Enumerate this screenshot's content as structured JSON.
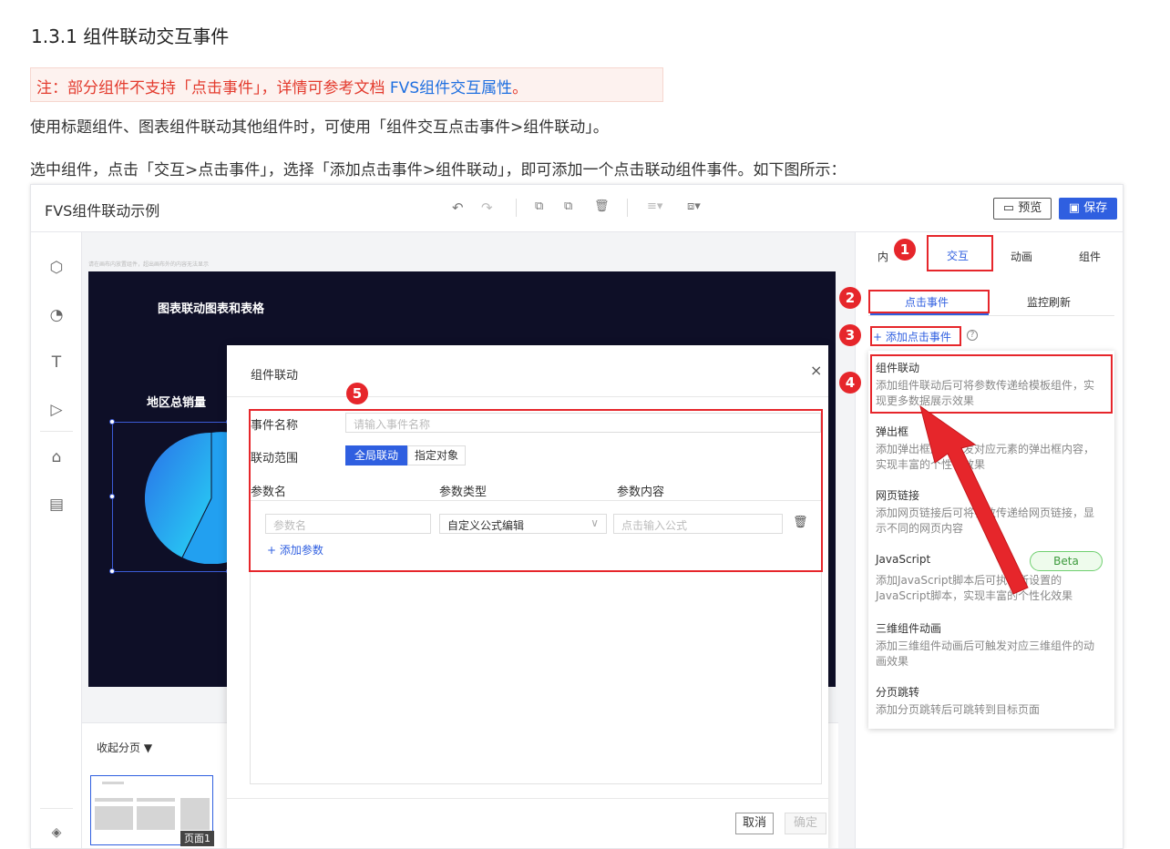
{
  "doc": {
    "title": "1.3.1 组件联动交互事件",
    "note_text": "注：部分组件不支持「点击事件」，详情可参考文档 ",
    "note_link": "FVS组件交互属性",
    "note_dot": "。",
    "para1": "使用标题组件、图表组件联动其他组件时，可使用「组件交互点击事件>组件联动」。",
    "para2": "选中组件，点击「交互>点击事件」，选择「添加点击事件>组件联动」，即可添加一个点击联动组件事件。如下图所示："
  },
  "app": {
    "title": "FVS组件联动示例",
    "preview_label": "预览",
    "save_label": "保存",
    "canvas_hint": "请在画布内放置组件，超出画布外的内容无法显示",
    "canvas_title": "图表联动图表和表格",
    "region_title": "地区总销量",
    "collapse_label": "收起分页 ▼",
    "page_name": "页面1"
  },
  "dialog": {
    "title": "组件联动",
    "close": "×",
    "event_name_label": "事件名称",
    "event_name_placeholder": "请输入事件名称",
    "scope_label": "联动范围",
    "scope_global": "全局联动",
    "scope_target": "指定对象",
    "col_param_name": "参数名",
    "col_param_type": "参数类型",
    "col_param_content": "参数内容",
    "param_name_placeholder": "参数名",
    "param_type_value": "自定义公式编辑",
    "param_content_placeholder": "点击输入公式",
    "add_param": "+ 添加参数",
    "cancel": "取消",
    "ok": "确定"
  },
  "right_panel": {
    "tabs": [
      "内",
      "交互",
      "动画",
      "组件"
    ],
    "subtab_click": "点击事件",
    "subtab_refresh": "监控刷新",
    "add_event": "+ 添加点击事件",
    "help": "?",
    "menu": [
      {
        "title": "组件联动",
        "desc": "添加组件联动后可将参数传递给模板组件，实现更多数据展示效果"
      },
      {
        "title": "弹出框",
        "desc": "添加弹出框后可触发对应元素的弹出框内容，实现丰富的个性化效果"
      },
      {
        "title": "网页链接",
        "desc": "添加网页链接后可将参数传递给网页链接，显示不同的网页内容"
      },
      {
        "title": "JavaScript",
        "desc": "添加JavaScript脚本后可执行所设置的JavaScript脚本，实现丰富的个性化效果"
      },
      {
        "title": "三维组件动画",
        "desc": "添加三维组件动画后可触发对应三维组件的动画效果"
      },
      {
        "title": "分页跳转",
        "desc": "添加分页跳转后可跳转到目标页面"
      }
    ],
    "beta": "Beta"
  },
  "callouts": [
    "1",
    "2",
    "3",
    "4",
    "5"
  ],
  "colors": {
    "accent": "#2f5fe0",
    "callout_red": "#e6262b",
    "canvas_bg": "#0e0f27"
  }
}
